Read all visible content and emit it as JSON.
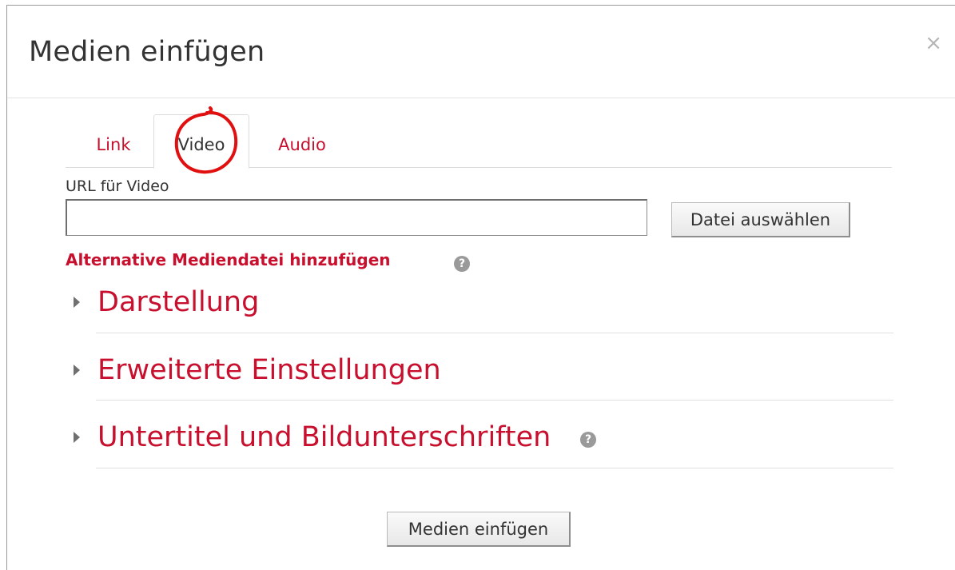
{
  "dialog": {
    "title": "Medien einfügen",
    "close_label": "×"
  },
  "tabs": [
    {
      "label": "Link",
      "active": false
    },
    {
      "label": "Video",
      "active": true
    },
    {
      "label": "Audio",
      "active": false
    }
  ],
  "url_field": {
    "label": "URL für Video",
    "value": "",
    "placeholder": ""
  },
  "choose_file_label": "Datei auswählen",
  "alternative_link": "Alternative Mediendatei hinzufügen",
  "help_glyph": "?",
  "sections": [
    {
      "label": "Darstellung"
    },
    {
      "label": "Erweiterte Einstellungen"
    },
    {
      "label": "Untertitel und Bildunterschriften"
    }
  ],
  "insert_button_label": "Medien einfügen",
  "colors": {
    "accent": "#c8102e",
    "annotation": "#e01010"
  },
  "icons": {
    "close": "close-icon",
    "help": "help-icon",
    "caret": "caret-right-icon"
  }
}
